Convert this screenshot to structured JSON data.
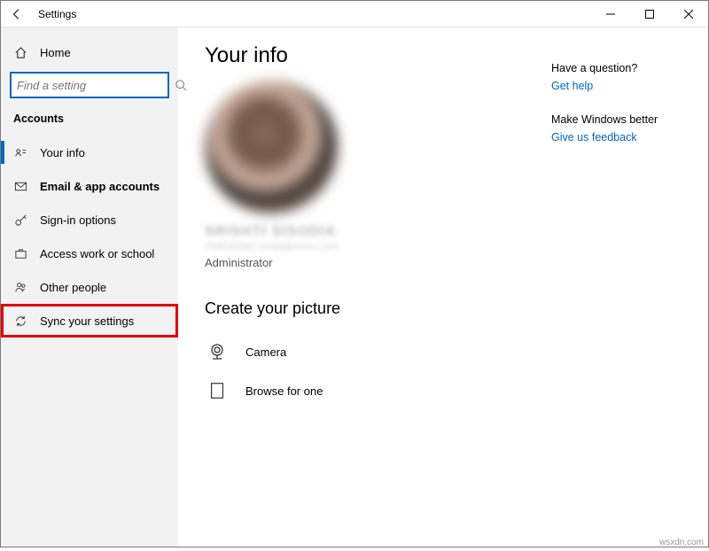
{
  "window": {
    "title": "Settings"
  },
  "search": {
    "placeholder": "Find a setting"
  },
  "home_label": "Home",
  "section_header": "Accounts",
  "nav": [
    {
      "icon": "person-card-icon",
      "label": "Your info",
      "selected": true,
      "bold": false,
      "highlight": false
    },
    {
      "icon": "mail-icon",
      "label": "Email & app accounts",
      "selected": false,
      "bold": true,
      "highlight": false
    },
    {
      "icon": "key-icon",
      "label": "Sign-in options",
      "selected": false,
      "bold": false,
      "highlight": false
    },
    {
      "icon": "briefcase-icon",
      "label": "Access work or school",
      "selected": false,
      "bold": false,
      "highlight": false
    },
    {
      "icon": "people-icon",
      "label": "Other people",
      "selected": false,
      "bold": false,
      "highlight": false
    },
    {
      "icon": "sync-icon",
      "label": "Sync your settings",
      "selected": false,
      "bold": false,
      "highlight": true
    }
  ],
  "main": {
    "title": "Your info",
    "user_name": "SRISHTI SISODIA",
    "user_email": "TWE/60362.email@mhnu.com",
    "user_role": "Administrator",
    "create_picture_heading": "Create your picture",
    "options": [
      {
        "icon": "camera-icon",
        "label": "Camera"
      },
      {
        "icon": "browse-icon",
        "label": "Browse for one"
      }
    ]
  },
  "right": {
    "q_heading": "Have a question?",
    "q_link": "Get help",
    "f_heading": "Make Windows better",
    "f_link": "Give us feedback"
  },
  "watermark": "wsxdn.com"
}
